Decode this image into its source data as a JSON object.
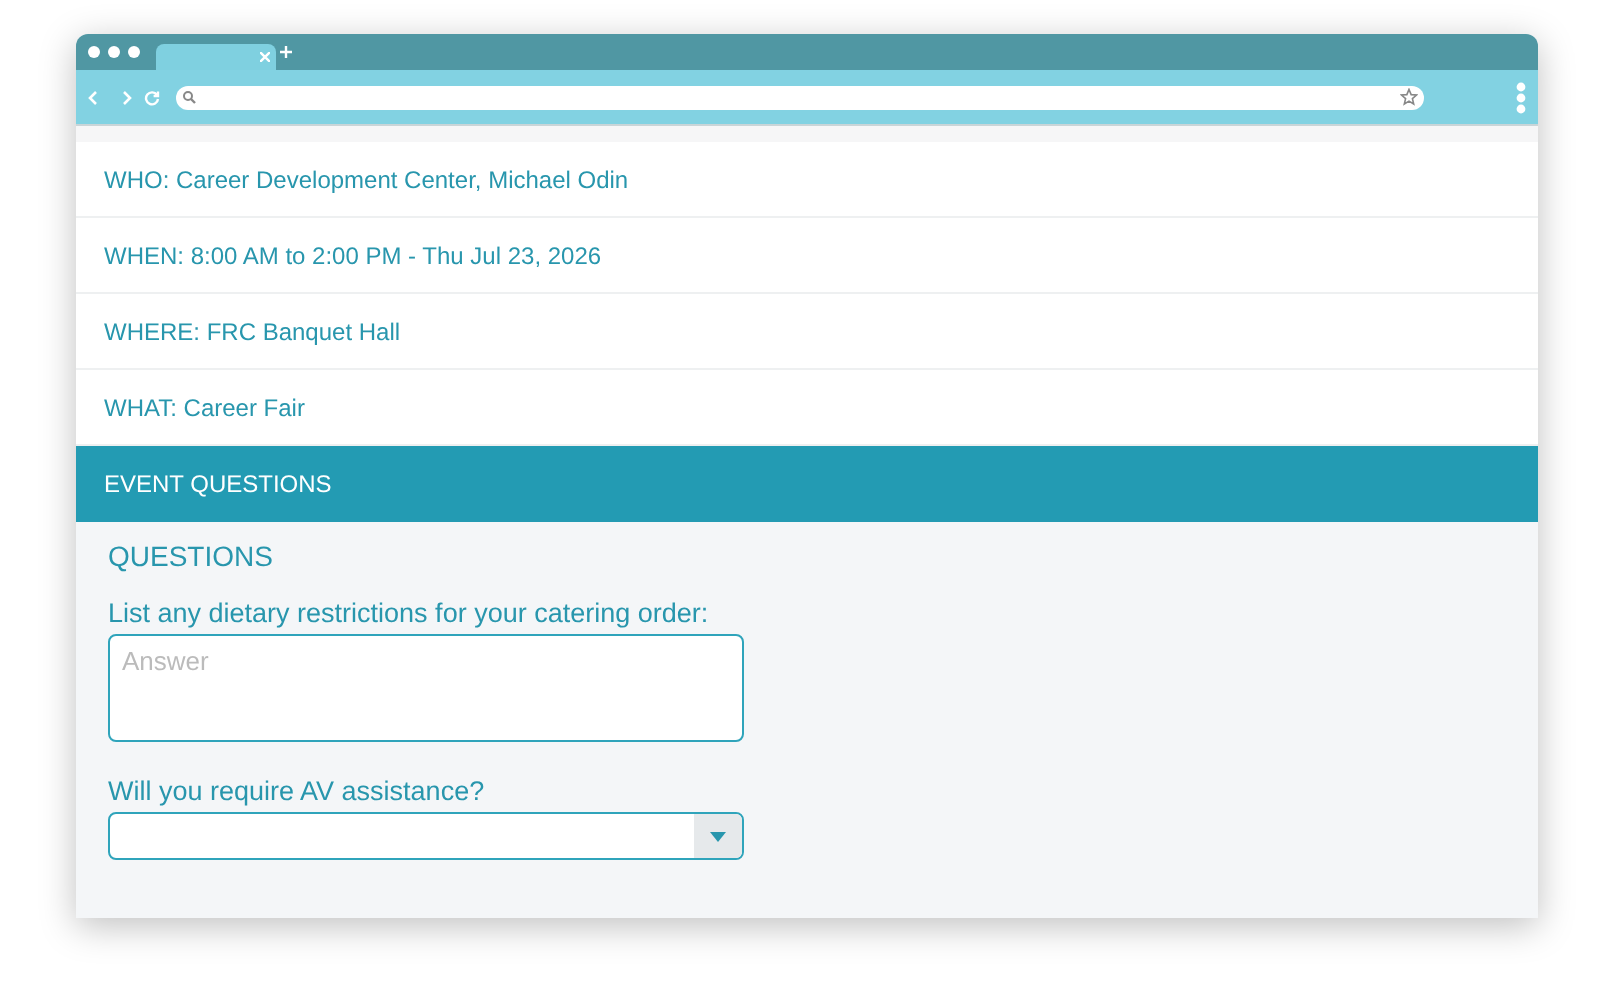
{
  "details": [
    {
      "text": "WHO: Career Development Center, Michael Odin"
    },
    {
      "text": "WHEN: 8:00 AM to 2:00 PM - Thu Jul 23, 2026"
    },
    {
      "text": "WHERE: FRC Banquet Hall"
    },
    {
      "text": "WHAT: Career Fair"
    }
  ],
  "section": {
    "title": "EVENT QUESTIONS",
    "heading": "QUESTIONS",
    "questions": [
      {
        "kind": "textarea",
        "label": "List any dietary restrictions for your catering order:",
        "placeholder": "Answer"
      },
      {
        "kind": "select",
        "label": "Will you require AV assistance?"
      }
    ]
  }
}
